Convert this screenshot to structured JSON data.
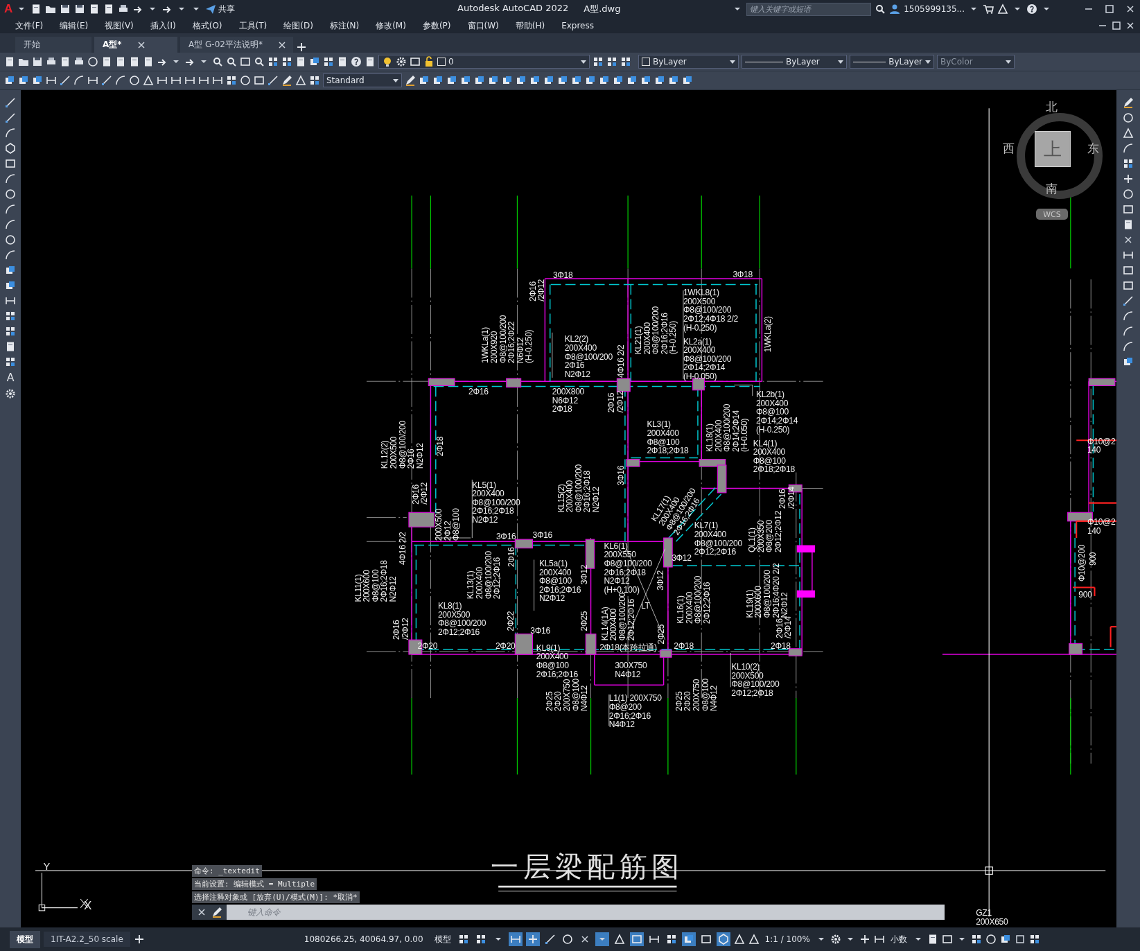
{
  "app_logo": "A",
  "window": {
    "title": "Autodesk AutoCAD 2022",
    "file": "A型.dwg"
  },
  "quick_access": {
    "share": "共享"
  },
  "search": {
    "placeholder": "键入关键字或短语"
  },
  "user": {
    "name": "1505999135..."
  },
  "menu": [
    "文件(F)",
    "编辑(E)",
    "视图(V)",
    "插入(I)",
    "格式(O)",
    "工具(T)",
    "绘图(D)",
    "标注(N)",
    "修改(M)",
    "参数(P)",
    "窗口(W)",
    "帮助(H)",
    "Express"
  ],
  "file_tabs": [
    {
      "label": "开始",
      "selected": false,
      "closable": false
    },
    {
      "label": "A型*",
      "selected": true,
      "closable": true
    },
    {
      "label": "A型 G-02平法说明*",
      "selected": false,
      "closable": true
    }
  ],
  "toolbar": {
    "layer": "0",
    "color_control": "ByLayer",
    "linetype": "ByLayer",
    "lineweight": "ByLayer",
    "plot_style": {
      "value": "ByColor",
      "disabled": true
    },
    "text_style": "Standard"
  },
  "left_toolbar": {
    "text_tool": "A"
  },
  "viewcube": {
    "north": "北",
    "west": "西",
    "east": "东",
    "south": "南",
    "face": "上",
    "ucs": "WCS"
  },
  "ucs_icon": {
    "y": "Y",
    "x": "X"
  },
  "drawing": {
    "title": "一层梁配筋图",
    "annotations": [
      {
        "kind": "horizontal",
        "lines": [
          "3Φ18"
        ]
      },
      {
        "kind": "horizontal",
        "lines": [
          "3Φ18"
        ]
      },
      {
        "kind": "horizontal",
        "lines": [
          "1WKL8(1)",
          "200X500",
          "Φ8@100/200",
          "2Φ12;4Φ18 2/2",
          "(H-0.250)"
        ]
      },
      {
        "kind": "horizontal",
        "lines": [
          "KL2(2)",
          "200X400",
          "Φ8@100/200",
          "2Φ16",
          "N2Φ12"
        ]
      },
      {
        "kind": "horizontal",
        "lines": [
          "KL2a(1)",
          "200X400",
          "Φ8@100/200",
          "2Φ14;2Φ14",
          "(H-0.050)"
        ]
      },
      {
        "kind": "horizontal",
        "lines": [
          "2Φ16"
        ]
      },
      {
        "kind": "horizontal",
        "lines": [
          "200X800",
          "N6Φ12",
          "2Φ18"
        ]
      },
      {
        "kind": "horizontal",
        "lines": [
          "KL2b(1)",
          "200X400",
          "Φ8@100",
          "2Φ14;2Φ14",
          "(H-0.250)"
        ]
      },
      {
        "kind": "horizontal",
        "lines": [
          "KL3(1)",
          "200X400",
          "Φ8@100",
          "2Φ18;2Φ18"
        ]
      },
      {
        "kind": "horizontal",
        "lines": [
          "KL4(1)",
          "200X400",
          "Φ8@100",
          "2Φ18;2Φ18"
        ]
      },
      {
        "kind": "horizontal",
        "lines": [
          "KL5(1)",
          "200X400",
          "Φ8@100/200",
          "2Φ16;2Φ18",
          "N2Φ12"
        ]
      },
      {
        "kind": "horizontal",
        "lines": [
          "3Φ16"
        ]
      },
      {
        "kind": "horizontal",
        "lines": [
          "3Φ16"
        ]
      },
      {
        "kind": "horizontal",
        "lines": [
          "KL5a(1)",
          "200X400",
          "Φ8@100",
          "2Φ16;2Φ16",
          "N2Φ12"
        ]
      },
      {
        "kind": "horizontal",
        "lines": [
          "KL6(1)",
          "200X550",
          "Φ8@100/200",
          "2Φ16;2Φ18",
          "N2Φ12",
          "(H+0.100)"
        ]
      },
      {
        "kind": "horizontal",
        "lines": [
          "3Φ12"
        ]
      },
      {
        "kind": "horizontal",
        "lines": [
          "KL7(1)",
          "200X400",
          "Φ8@100/200",
          "2Φ12;2Φ16"
        ]
      },
      {
        "kind": "horizontal",
        "lines": [
          "LT"
        ]
      },
      {
        "kind": "horizontal",
        "lines": [
          "KL8(1)",
          "200X500",
          "Φ8@100/200",
          "2Φ12;2Φ16"
        ]
      },
      {
        "kind": "horizontal",
        "lines": [
          "2Φ20"
        ]
      },
      {
        "kind": "horizontal",
        "lines": [
          "2Φ20"
        ]
      },
      {
        "kind": "horizontal",
        "lines": [
          "3Φ16"
        ]
      },
      {
        "kind": "horizontal",
        "lines": [
          "KL9(1)",
          "200X400",
          "Φ8@100",
          "2Φ16;2Φ16"
        ]
      },
      {
        "kind": "horizontal",
        "lines": [
          "2Φ18(本跨拉通)"
        ]
      },
      {
        "kind": "horizontal",
        "lines": [
          "2Φ18"
        ]
      },
      {
        "kind": "horizontal",
        "lines": [
          "2Φ18"
        ]
      },
      {
        "kind": "horizontal",
        "lines": [
          "300X750",
          "N4Φ12"
        ]
      },
      {
        "kind": "horizontal",
        "lines": [
          "KL10(2)",
          "200X500",
          "Φ8@100/200",
          "2Φ12;2Φ18"
        ]
      },
      {
        "kind": "horizontal",
        "lines": [
          "L1(1) 200X750",
          "Φ8@200",
          "2Φ16;2Φ16",
          "N4Φ12"
        ]
      },
      {
        "kind": "vertical",
        "lines": [
          "2Φ16",
          "/2Φ12"
        ]
      },
      {
        "kind": "vertical",
        "lines": [
          "1WKLa(1)",
          "200X920",
          "Φ8@100/200",
          "2Φ16;2Φ22",
          "N6Φ12",
          "(H-0.250)"
        ]
      },
      {
        "kind": "vertical",
        "lines": [
          "4Φ16 2/2"
        ]
      },
      {
        "kind": "vertical",
        "lines": [
          "KL21(1)",
          "200X400",
          "Φ8@100/200",
          "2Φ16;2Φ16",
          "(H-0.250)"
        ]
      },
      {
        "kind": "vertical",
        "lines": [
          "1WKLa(2)"
        ]
      },
      {
        "kind": "vertical",
        "lines": [
          "2Φ16",
          "/2Φ12"
        ]
      },
      {
        "kind": "vertical",
        "lines": [
          "KL12(2)",
          "200X500",
          "Φ8@100/200",
          "2Φ16",
          "N2Φ12"
        ]
      },
      {
        "kind": "vertical",
        "lines": [
          "2Φ18"
        ]
      },
      {
        "kind": "vertical",
        "lines": [
          "KL18(1)",
          "200X400",
          "Φ8@100/200",
          "2Φ14;2Φ14",
          "(H-0.050)"
        ]
      },
      {
        "kind": "vertical",
        "lines": [
          "KL15(2)",
          "200X400",
          "Φ8@100/200",
          "2Φ16;2Φ18",
          "N2Φ12"
        ]
      },
      {
        "kind": "vertical",
        "lines": [
          "3Φ16"
        ]
      },
      {
        "kind": "vertical",
        "lines": [
          "2Φ16",
          "/2Φ12"
        ]
      },
      {
        "kind": "vertical",
        "lines": [
          "200X500",
          "2Φ12",
          "Φ8@100"
        ]
      },
      {
        "kind": "vertical",
        "lines": [
          "2Φ16",
          "/2Φ14"
        ]
      },
      {
        "kind": "vertical",
        "lines": [
          "QL1(1)",
          "200X350",
          "Φ8@200",
          "2Φ12;2Φ12"
        ]
      },
      {
        "kind": "vertical",
        "lines": [
          "4Φ16 2/2"
        ]
      },
      {
        "kind": "vertical",
        "lines": [
          "KL11(1)",
          "200X600",
          "Φ8@100",
          "2Φ16;2Φ18",
          "N2Φ12"
        ]
      },
      {
        "kind": "vertical",
        "lines": [
          "KL13(1)",
          "200X400",
          "Φ8@100/200",
          "2Φ12;2Φ16"
        ]
      },
      {
        "kind": "vertical",
        "lines": [
          "2Φ16"
        ]
      },
      {
        "kind": "vertical",
        "lines": [
          "3Φ12"
        ]
      },
      {
        "kind": "vertical",
        "lines": [
          "KL14(1A)",
          "200X400",
          "Φ8@100/200",
          "2Φ12;2Φ16"
        ]
      },
      {
        "kind": "vertical",
        "lines": [
          "3Φ12"
        ]
      },
      {
        "kind": "vertical",
        "lines": [
          "KL16(1)",
          "200X400",
          "Φ8@100/200",
          "2Φ12;2Φ16"
        ]
      },
      {
        "kind": "vertical",
        "lines": [
          "KL19(1)",
          "200X600",
          "Φ8@100/200",
          "2Φ16;4Φ20 2/2",
          "N2Φ12"
        ]
      },
      {
        "kind": "vertical",
        "lines": [
          "2Φ16",
          "/2Φ12"
        ]
      },
      {
        "kind": "vertical",
        "lines": [
          "2Φ22"
        ]
      },
      {
        "kind": "vertical",
        "lines": [
          "2Φ25"
        ]
      },
      {
        "kind": "vertical",
        "lines": [
          "2Φ25"
        ]
      },
      {
        "kind": "vertical",
        "lines": [
          "2Φ16",
          "/2Φ14"
        ]
      },
      {
        "kind": "vertical",
        "lines": [
          "2Φ25",
          "2Φ20",
          "200X750",
          "Φ8@100",
          "N4Φ12"
        ]
      },
      {
        "kind": "vertical",
        "lines": [
          "2Φ25",
          "2Φ20",
          "200X750",
          "Φ8@100",
          "N4Φ12"
        ]
      },
      {
        "kind": "diagonal",
        "lines": [
          "KL17(1)",
          "200X400",
          "Φ8@100/200",
          "2Φ16;2Φ16"
        ]
      },
      {
        "kind": "horizontal",
        "lines": [
          "Φ10@2",
          "140"
        ]
      },
      {
        "kind": "horizontal",
        "lines": [
          "Φ10@2",
          "140"
        ]
      },
      {
        "kind": "vertical",
        "lines": [
          "Φ10@200"
        ]
      },
      {
        "kind": "vertical",
        "lines": [
          "900"
        ]
      },
      {
        "kind": "horizontal",
        "lines": [
          "900"
        ]
      },
      {
        "kind": "horizontal",
        "lines": [
          "GZ1",
          "200X650"
        ]
      }
    ]
  },
  "command_line": {
    "history": [
      "命令: _textedit",
      "当前设置: 编辑模式 = Multiple",
      "选择注释对象或 [放弃(U)/模式(M)]: *取消*"
    ],
    "placeholder": "键入命令"
  },
  "layout_tabs": [
    {
      "label": "模型",
      "selected": true
    },
    {
      "label": "1IT-A2.2_50 scale",
      "selected": false
    }
  ],
  "status_bar": {
    "coordinates": "1080266.25, 40064.97, 0.00",
    "space": "模型",
    "toggles": [
      {
        "on": false
      },
      {
        "on": false
      },
      {
        "on": false
      },
      {
        "on": true
      },
      {
        "on": true
      },
      {
        "on": false
      },
      {
        "on": false
      },
      {
        "on": false
      },
      {
        "on": true
      },
      {
        "on": false
      },
      {
        "on": true
      },
      {
        "on": false
      },
      {
        "on": false
      },
      {
        "on": true
      },
      {
        "on": false
      },
      {
        "on": true
      }
    ],
    "scale": "1:1 / 100%",
    "units": "小数"
  }
}
